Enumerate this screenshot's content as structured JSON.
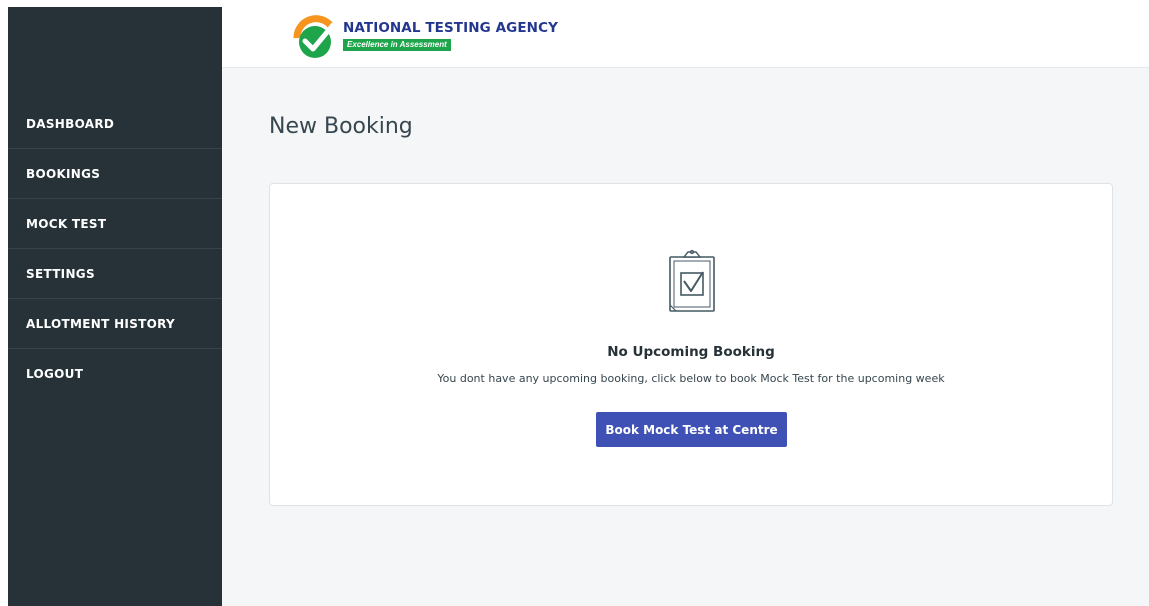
{
  "header": {
    "logo_title": "NATIONAL TESTING AGENCY",
    "logo_tagline": "Excellence in Assessment",
    "logo_icon": "checkmark-badge-icon"
  },
  "sidebar": {
    "items": [
      {
        "label": "DASHBOARD"
      },
      {
        "label": "BOOKINGS"
      },
      {
        "label": "MOCK TEST"
      },
      {
        "label": "SETTINGS"
      },
      {
        "label": "ALLOTMENT HISTORY"
      },
      {
        "label": "LOGOUT"
      }
    ]
  },
  "main": {
    "title": "New Booking",
    "empty_state": {
      "icon": "clipboard-check-icon",
      "title": "No Upcoming Booking",
      "message": "You dont have any upcoming booking, click below to book Mock Test for the upcoming week",
      "button_label": "Book Mock Test at Centre"
    }
  },
  "colors": {
    "sidebar_bg": "#263238",
    "brand_blue": "#24378f",
    "brand_green": "#1ea44a",
    "brand_orange": "#f7941d",
    "button_bg": "#3f51b5",
    "content_bg": "#f5f6f7"
  }
}
